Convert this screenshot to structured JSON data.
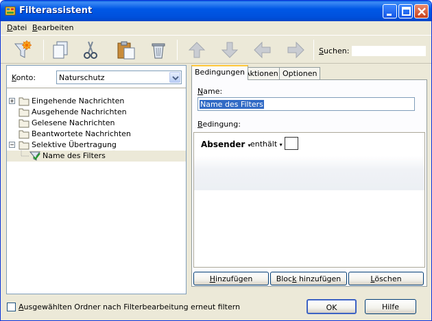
{
  "window": {
    "title": "Filterassistent"
  },
  "menu": [
    {
      "first": "D",
      "rest": "atei"
    },
    {
      "first": "B",
      "rest": "earbeiten"
    }
  ],
  "toolbar": {
    "icons": [
      "new-filter-icon",
      "copy-icon",
      "cut-icon",
      "paste-icon",
      "delete-icon",
      "move-up-icon",
      "move-down-icon",
      "move-left-icon",
      "move-right-icon"
    ],
    "search_label_first": "S",
    "search_label_rest": "uchen:",
    "search_value": ""
  },
  "konto": {
    "label_first": "K",
    "label_rest": "onto:",
    "value": "Naturschutz"
  },
  "tree": [
    {
      "label": "Eingehende Nachrichten",
      "expander": "+"
    },
    {
      "label": "Ausgehende Nachrichten",
      "expander": ""
    },
    {
      "label": "Gelesene Nachrichten",
      "expander": ""
    },
    {
      "label": "Beantwortete Nachrichten",
      "expander": ""
    },
    {
      "label": "Selektive Übertragung",
      "expander": "−"
    },
    {
      "label": "Name des Filters",
      "expander": ""
    }
  ],
  "tabs": [
    "Bedingungen",
    "Aktionen",
    "Optionen"
  ],
  "conditions": {
    "name_label_first": "N",
    "name_label_rest": "ame:",
    "name_value": "Name des Filters",
    "condition_label_first": "B",
    "condition_label_rest": "edingung:",
    "field": "Absender",
    "operator": "enthält",
    "arrow": "▾"
  },
  "buttons": {
    "add_pre": "",
    "add_u": "H",
    "add_post": "inzufügen",
    "add_block_pre": "Bloc",
    "add_block_u": "k",
    "add_block_post": " hinzufügen",
    "delete_pre": "",
    "delete_u": "L",
    "delete_post": "öschen",
    "ok": "OK",
    "help": "Hilfe"
  },
  "footer": {
    "refilter_pre": "",
    "refilter_u": "A",
    "refilter_post": "usgewählten Ordner nach Filterbearbeitung erneut filtern",
    "checked": false
  }
}
